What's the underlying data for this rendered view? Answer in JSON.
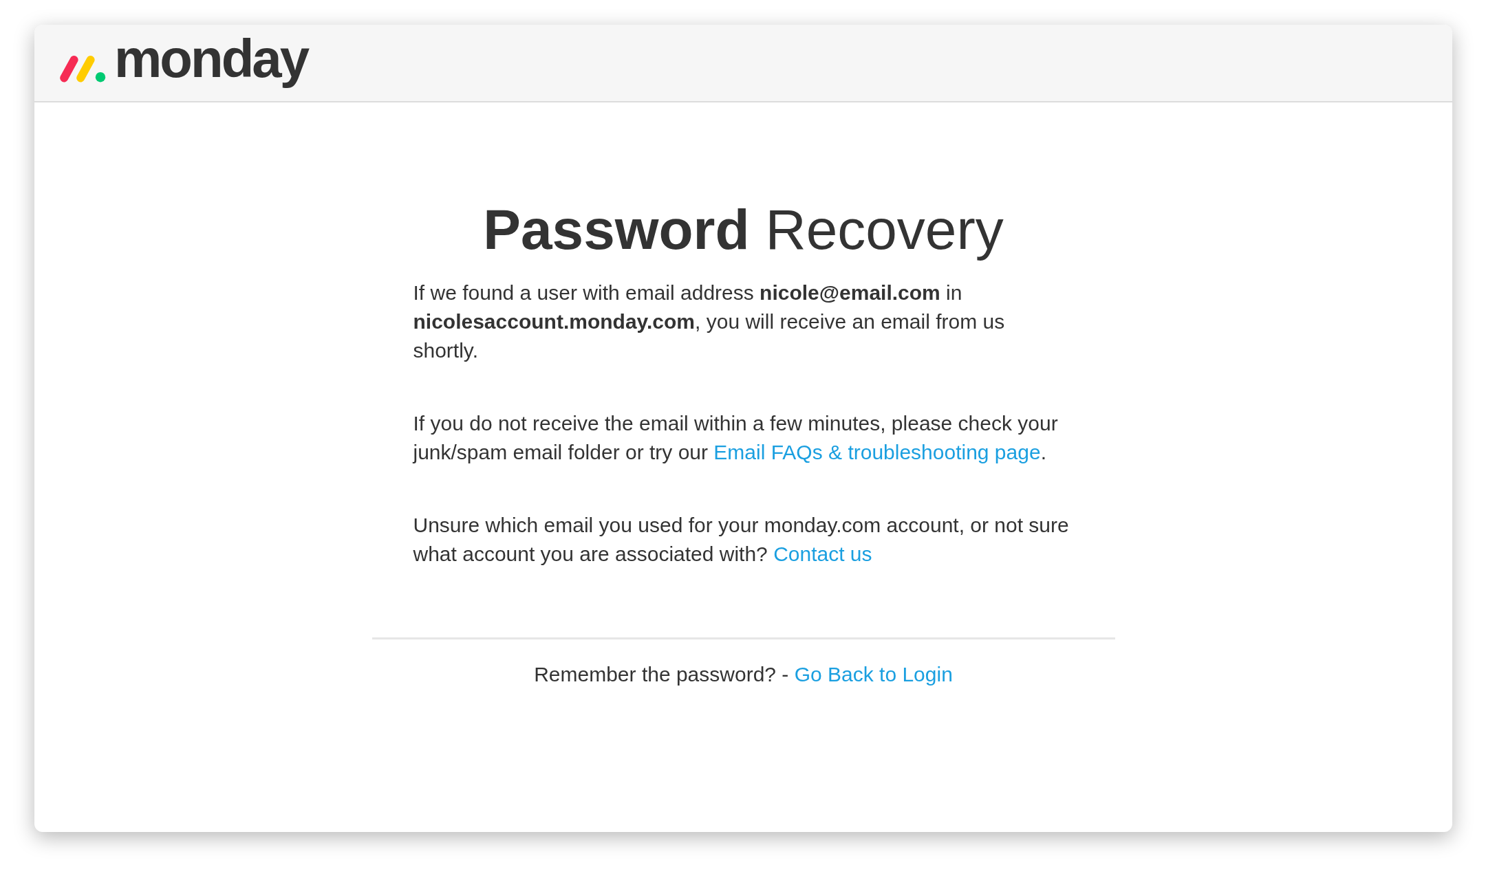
{
  "header": {
    "logo_text": "monday"
  },
  "title": "**Password** Recovery",
  "paragraphs": [
    [
      {
        "kind": "text",
        "text": "If we found a user with email address **nicole@email.com** in **nicolesaccount.monday.com**, you will receive an email from us shortly."
      }
    ],
    [
      {
        "kind": "text",
        "text": "If you do not receive the email within a few minutes, please check your junk/spam email folder or try our "
      },
      {
        "kind": "link",
        "text": "Email FAQs & troubleshooting page"
      },
      {
        "kind": "text",
        "text": "."
      }
    ],
    [
      {
        "kind": "text",
        "text": "Unsure which email you used for your monday.com account, or not sure what account you are associated with? "
      },
      {
        "kind": "link",
        "text": "Contact us"
      }
    ]
  ],
  "footer": [
    {
      "kind": "text",
      "text": "Remember the password? - "
    },
    {
      "kind": "link",
      "text": "Go Back to Login"
    }
  ]
}
